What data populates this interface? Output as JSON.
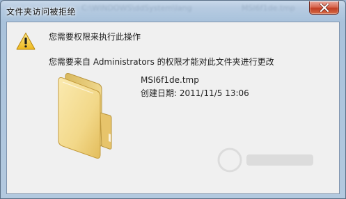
{
  "window": {
    "title": "文件夹访问被拒绝",
    "background_ghost_text": [
      "C:\\WINDOWS\\ddSystem\\lang",
      "MSI6f1de.tmp"
    ]
  },
  "dialog": {
    "headline": "您需要权限来执行此操作",
    "message": "您需要来自 Administrators 的权限才能对此文件夹进行更改",
    "file": {
      "name": "MSI6f1de.tmp",
      "date": "创建日期: 2011/11/5 13:06"
    }
  },
  "icons": {
    "warning": "warning-icon",
    "folder": "folder-icon",
    "close": "close-icon"
  },
  "colors": {
    "close_button": "#c94a2d",
    "warning_yellow": "#f3c623",
    "folder_yellow": "#f2d98a"
  }
}
